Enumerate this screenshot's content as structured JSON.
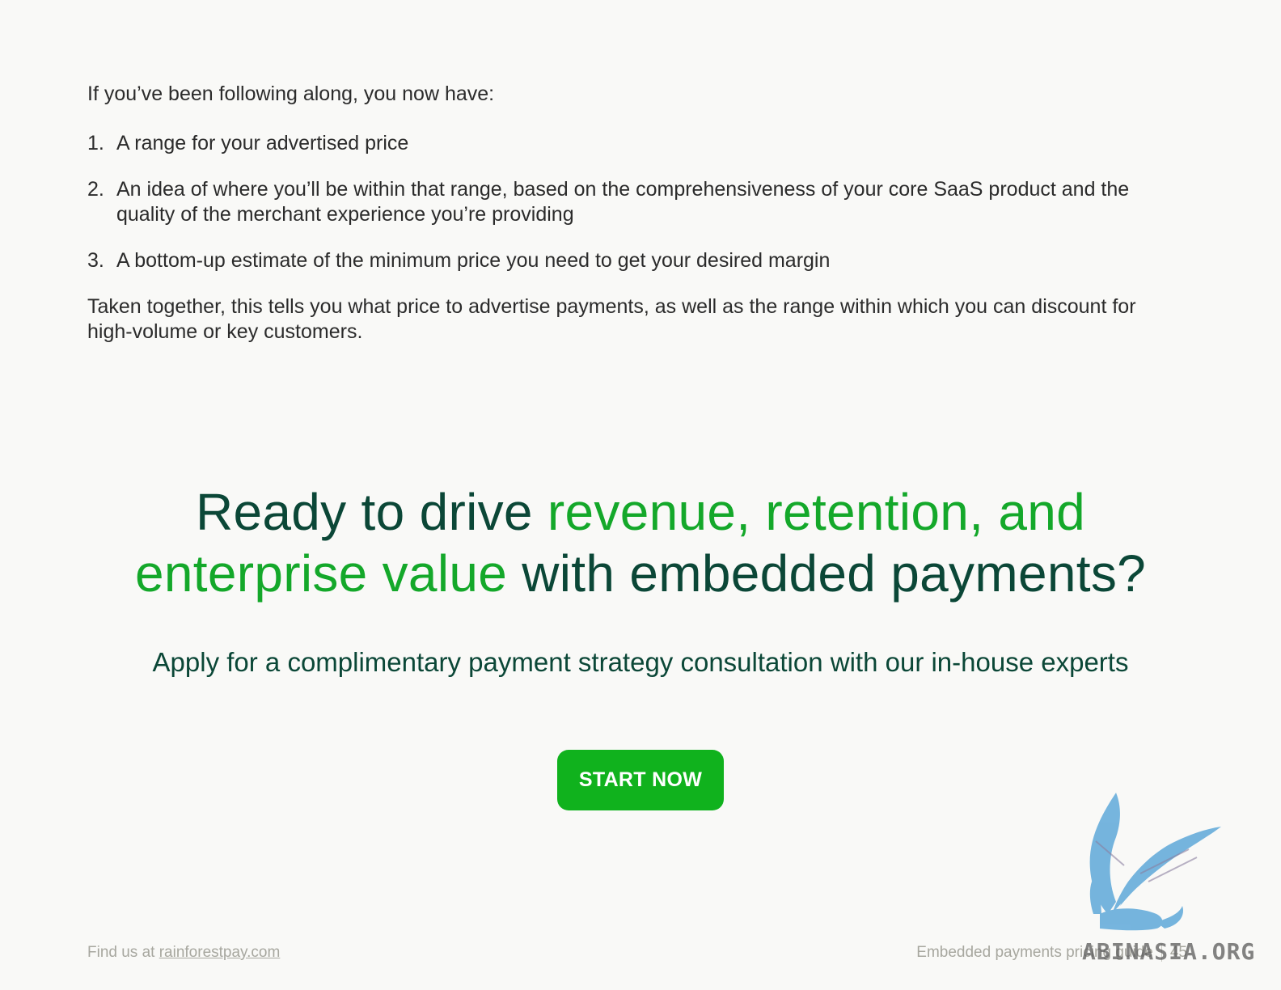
{
  "intro": "If you’ve been following along, you now have:",
  "steps": [
    {
      "num": "1.",
      "text": "A range for your advertised price"
    },
    {
      "num": "2.",
      "text": "An idea of where you’ll be within that range, based on the comprehensiveness of your core SaaS product and the quality of the merchant experience you’re providing"
    },
    {
      "num": "3.",
      "text": "A bottom-up estimate of the minimum price you need to get your desired margin"
    }
  ],
  "summary": "Taken together, this tells you what price to advertise payments, as well as the range within which you can discount for high-volume or key customers.",
  "headline": {
    "part1": "Ready to drive ",
    "accent1": "revenue, retention, and",
    "accent2": "enterprise value",
    "part2": " with embedded payments?"
  },
  "subhead": "Apply for a complimentary payment strategy consultation with our in-house experts",
  "cta_label": "START NOW",
  "footer": {
    "find_prefix": "Find us at ",
    "site_link": "rainforestpay.com",
    "guide_title": "Embedded payments pricing guide",
    "page_number": "45"
  },
  "watermark": {
    "text": "ABINASIA.ORG",
    "icon": "griffin-logo-icon"
  },
  "colors": {
    "headline_dark": "#0b4737",
    "accent_green": "#14a82a",
    "button_green": "#10b21d",
    "footer_gray": "#a7a79f"
  }
}
